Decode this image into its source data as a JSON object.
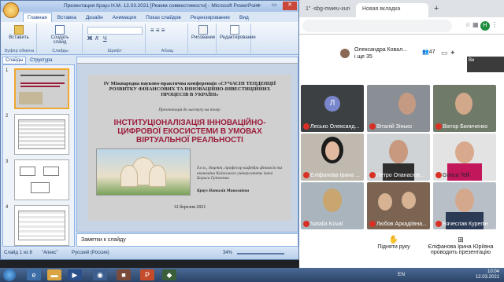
{
  "chrome": {
    "tabs": [
      "1\" -sbg-mweu-xun",
      "Новая вкладка"
    ],
    "new_tab": "+",
    "url": "",
    "profile_initial": "Н"
  },
  "meet": {
    "presenter_name": "Олександра Ковал...",
    "presenter_sub": "і ще 35",
    "people_count": "47",
    "self_label": "Ви",
    "participants": [
      {
        "name": "Лесько Олександ...",
        "initial": "Л"
      },
      {
        "name": "Віталій Зінько"
      },
      {
        "name": "Віктор Биличенко"
      },
      {
        "name": "Єліфанова Ірина ..."
      },
      {
        "name": "Петро Опанасюв..."
      },
      {
        "name": "Gonca Telli"
      },
      {
        "name": "Natalia Koval"
      },
      {
        "name": "Любов Аркадіївна..."
      },
      {
        "name": "Вячеслав Курепін"
      }
    ],
    "raise_hand": "Підняти руку",
    "presenting": "Єліфанова Ірина Юріївна проводить презентацію"
  },
  "ppt": {
    "title": "Презентация Крауз Н.М. 12.03.2021 [Режим совместимости] - Microsoft PowerPoint",
    "ribbon_tabs": [
      "Главная",
      "Вставка",
      "Дизайн",
      "Анимация",
      "Показ слайдов",
      "Рецензирование",
      "Вид"
    ],
    "ribbon_groups": [
      "Буфер обмена",
      "Слайды",
      "Шрифт",
      "Абзац",
      "Рисование",
      "Редактирование"
    ],
    "ribbon_buttons": {
      "paste": "Вставить",
      "new_slide": "Создать слайд",
      "drawing": "Рисование",
      "editing": "Редактирование"
    },
    "panel_tabs": [
      "Слайды",
      "Структура"
    ],
    "slide_numbers": [
      "1",
      "2",
      "3",
      "4"
    ],
    "notes": "Заметки к слайду",
    "status_slide": "Слайд 1 из 8",
    "status_theme": "\"Апекс\"",
    "status_lang": "Русский (Россия)",
    "zoom": "34%"
  },
  "slide": {
    "conference": "IV Міжнародна науково-практична конференція «СУЧАСНІ ТЕНДЕНЦІЇ РОЗВИТКУ ФІНАНСОВИХ ТА ІННОВАЦІЙНО-ІНВЕСТИЦІЙНИХ ПРОЦЕСІВ В УКРАЇНІ»",
    "presentation_for": "Презентація до виступу на тему:",
    "title": "ІНСТИТУЦІОНАЛІЗАЦІЯ ІННОВАЦІЙНО-ЦИФРОВОЇ ЕКОСИСТЕМИ В УМОВАХ ВІРТУАЛЬНОЇ РЕАЛЬНОСТІ",
    "author_info": "д.е.н., доцент, професор кафедри фінансів та економіки Київського університету імені Бориса Грінченка",
    "author_name": "Крауз Наталія Миколаївна",
    "date": "12 березня 2021"
  },
  "taskbar": {
    "lang": "EN",
    "time": "10:04",
    "date": "12.03.2021"
  }
}
